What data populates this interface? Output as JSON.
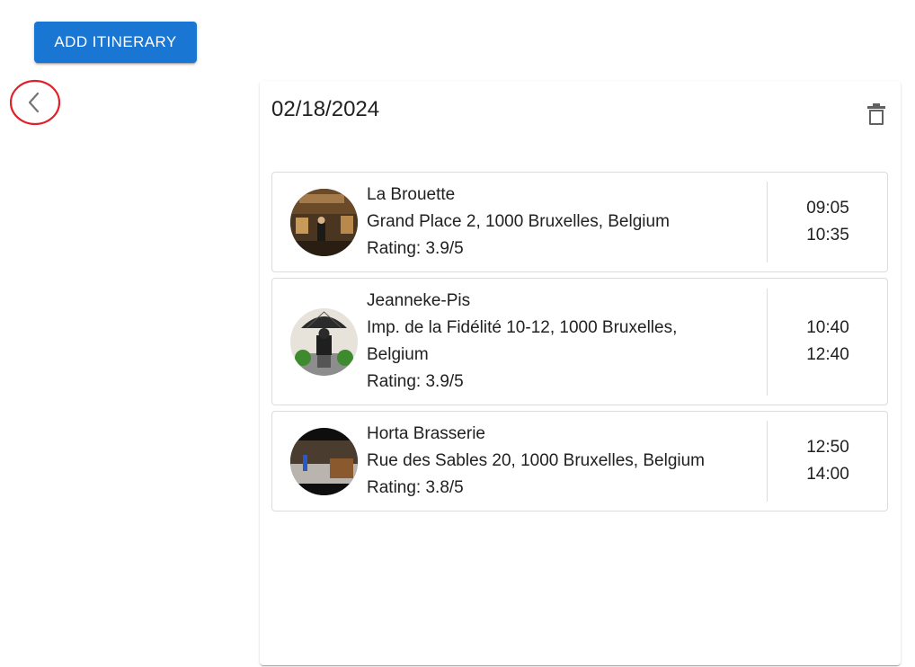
{
  "toolbar": {
    "add_itinerary_label": "ADD ITINERARY"
  },
  "icons": {
    "back": "chevron-left-icon",
    "delete": "trash-icon"
  },
  "colors": {
    "primary": "#1976d2",
    "annotation_circle": "#e0202a"
  },
  "itinerary": {
    "date": "02/18/2024",
    "items": [
      {
        "name": "La Brouette",
        "address": "Grand Place 2, 1000 Bruxelles, Belgium",
        "rating": "Rating: 3.9/5",
        "start": "09:05",
        "end": "10:35"
      },
      {
        "name": "Jeanneke-Pis",
        "address": "Imp. de la Fidélité 10-12, 1000 Bruxelles, Belgium",
        "rating": "Rating: 3.9/5",
        "start": "10:40",
        "end": "12:40"
      },
      {
        "name": "Horta Brasserie",
        "address": "Rue des Sables 20, 1000 Bruxelles, Belgium",
        "rating": "Rating: 3.8/5",
        "start": "12:50",
        "end": "14:00"
      }
    ]
  }
}
